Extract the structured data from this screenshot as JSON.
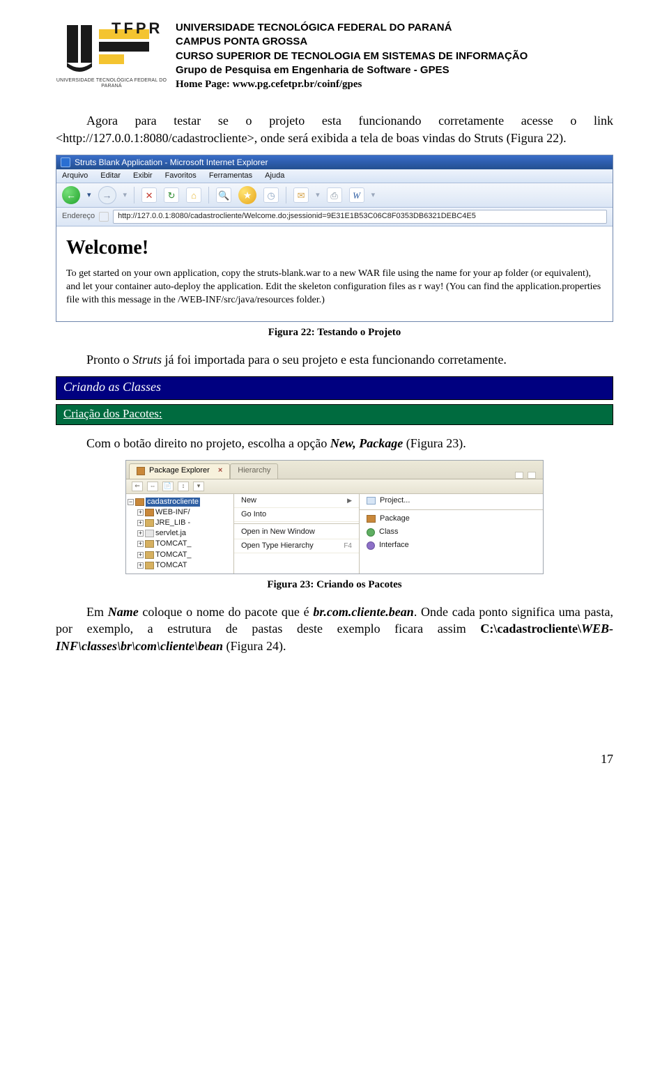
{
  "header": {
    "line1": "UNIVERSIDADE TECNOLÓGICA FEDERAL DO PARANÁ",
    "line2": "CAMPUS PONTA GROSSA",
    "line3": "CURSO SUPERIOR DE TECNOLOGIA EM SISTEMAS DE INFORMAÇÃO",
    "line4": "Grupo de Pesquisa em Engenharia de Software - GPES",
    "hp_label": "Home Page: ",
    "hp_url": "www.pg.cefetpr.br/coinf/gpes",
    "logo_caption": "UNIVERSIDADE TECNOLÓGICA FEDERAL DO PARANÁ"
  },
  "para1": {
    "prefix": "Agora para testar se o projeto esta funcionando corretamente acesse o link <",
    "link_text": "http://127.0.0.1:8080/cadastrocliente",
    "suffix": ">, onde será exibida a tela de boas vindas do Struts (Figura 22)."
  },
  "fig22": {
    "title_text": "Struts Blank Application - Microsoft Internet Explorer",
    "menu": [
      "Arquivo",
      "Editar",
      "Exibir",
      "Favoritos",
      "Ferramentas",
      "Ajuda"
    ],
    "addr_label": "Endereço",
    "url": "http://127.0.0.1:8080/cadastrocliente/Welcome.do;jsessionid=9E31E1B53C06C8F0353DB6321DEBC4E5",
    "h1": "Welcome!",
    "p": "To get started on your own application, copy the struts-blank.war to a new WAR file using the name for your ap folder (or equivalent), and let your container auto-deploy the application. Edit the skeleton configuration files as r way! (You can find the application.properties file with this message in the /WEB-INF/src/java/resources folder.)",
    "caption": "Figura 22: Testando o Projeto"
  },
  "para2": {
    "prefix": "Pronto o ",
    "struts": "Struts",
    "suffix": " já foi importada para o seu projeto e esta funcionando corretamente."
  },
  "bar_blue": "Criando as Classes",
  "bar_green": "Criação dos Pacotes:",
  "para3": {
    "prefix": "Com o botão direito no projeto, escolha a opção ",
    "opt": "New, Package",
    "suffix": " (Figura 23)."
  },
  "fig23": {
    "tab_active": "Package Explorer",
    "tab_inactive": "Hierarchy",
    "project_name": "cadastrocliente",
    "children": [
      "WEB-INF/",
      "JRE_LIB -",
      "servlet.ja",
      "TOMCAT_",
      "TOMCAT_",
      "TOMCAT"
    ],
    "ctx_left": {
      "new": "New",
      "go_into": "Go Into",
      "open_new_window": "Open in New Window",
      "open_type_hierarchy": "Open Type Hierarchy",
      "f4": "F4"
    },
    "ctx_right": {
      "project": "Project...",
      "package": "Package",
      "class": "Class",
      "interface": "Interface"
    },
    "caption": "Figura 23: Criando os Pacotes"
  },
  "para4": {
    "p1_prefix": "Em ",
    "name": "Name",
    "p1_mid": " coloque o nome do pacote que é ",
    "pkg": "br.com.cliente.bean",
    "p1_suffix": ". Onde cada ponto significa uma pasta, por exemplo, a estrutura de pastas deste exemplo ficara assim ",
    "path_prefix": "C:\\cadastrocliente\\",
    "path_italic": "WEB-INF\\classes\\br\\com\\cliente\\bean",
    "p1_end": " (Figura 24)."
  },
  "page_number": "17"
}
